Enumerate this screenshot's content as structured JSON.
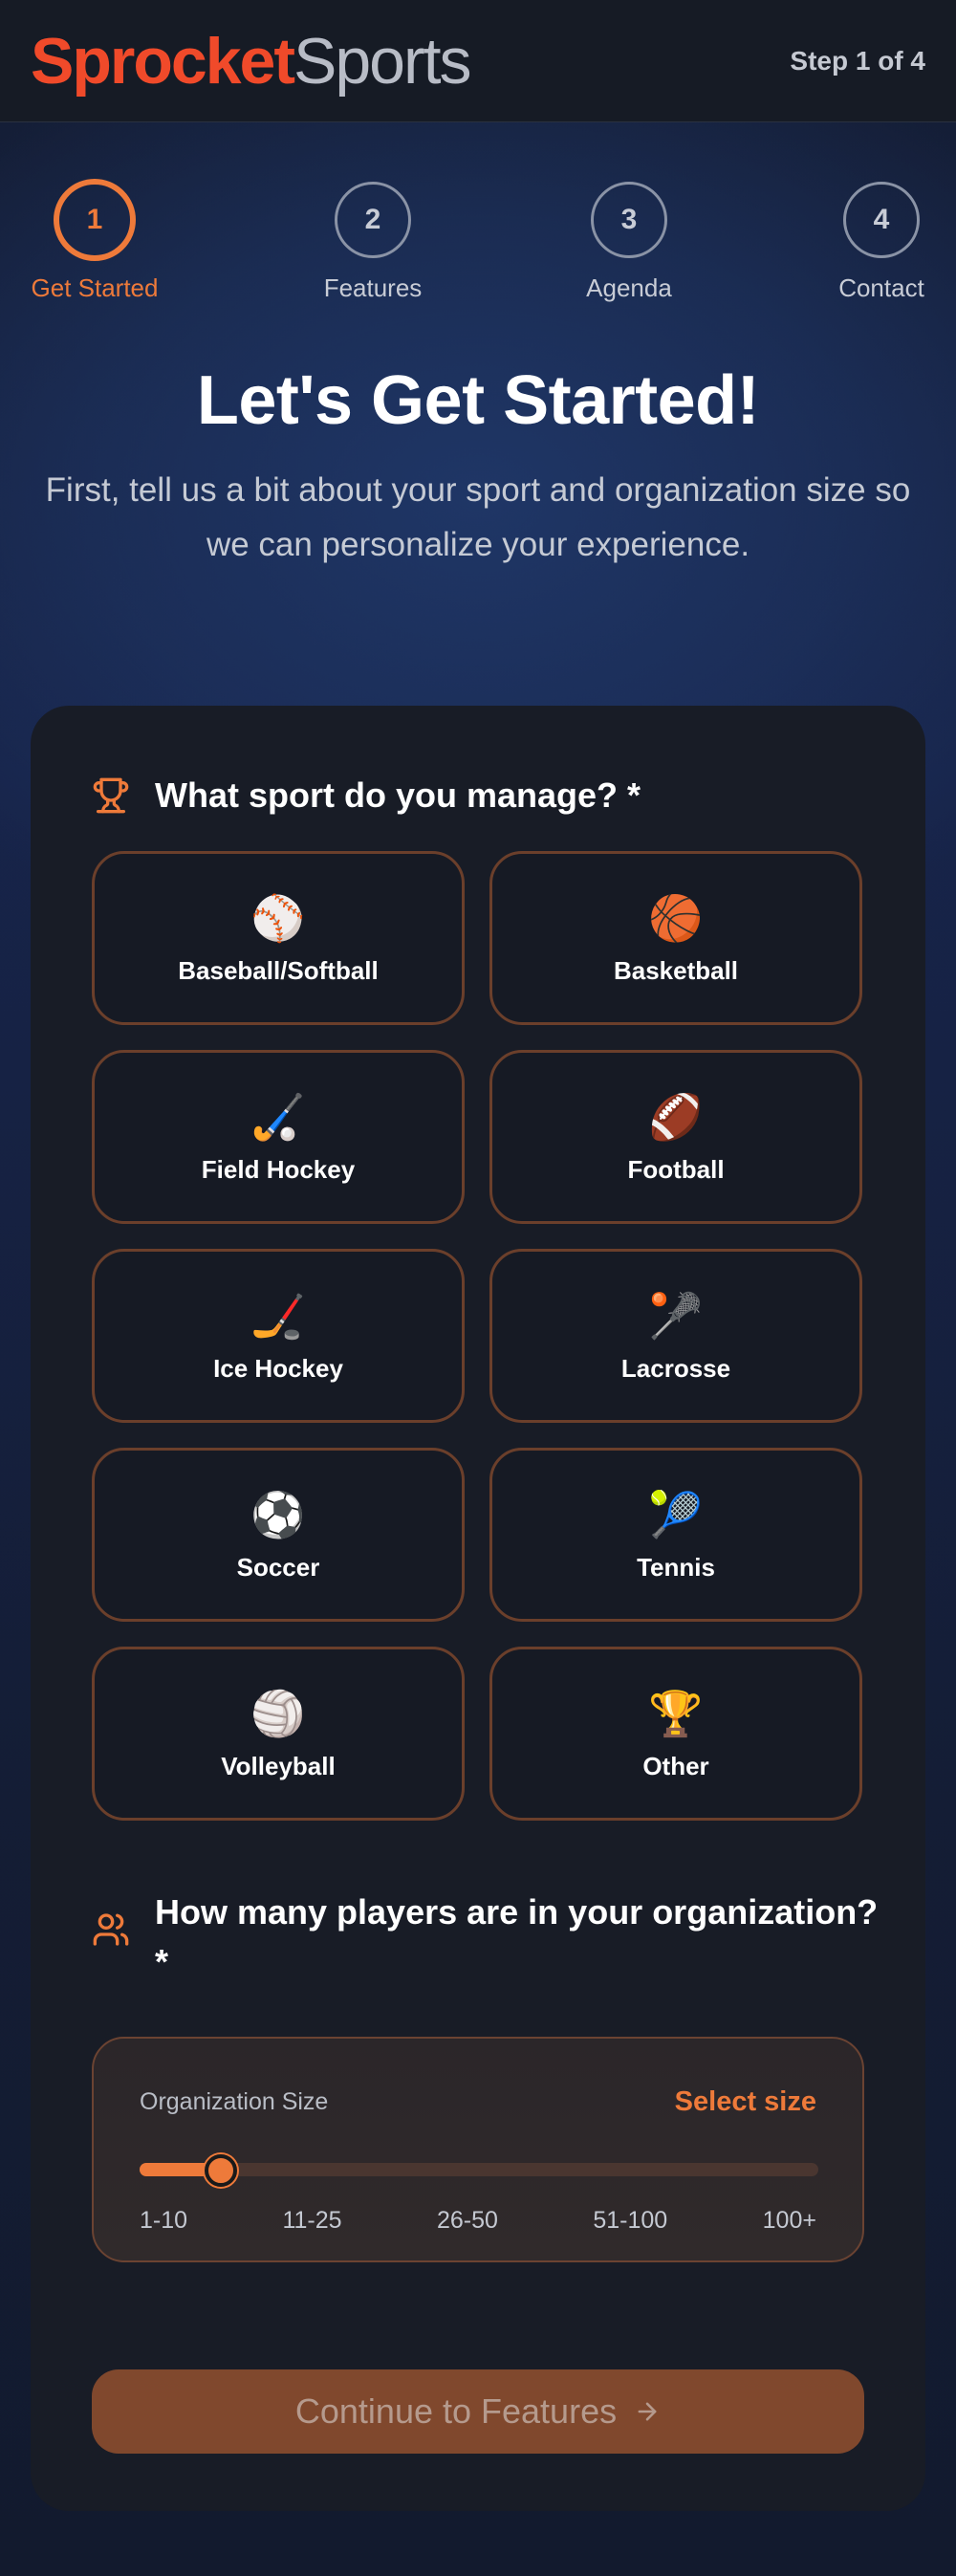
{
  "header": {
    "brand_primary": "Sprocket",
    "brand_secondary": "Sports",
    "step_text": "Step 1 of 4"
  },
  "stepper": {
    "steps": [
      {
        "number": "1",
        "label": "Get Started",
        "active": true
      },
      {
        "number": "2",
        "label": "Features",
        "active": false
      },
      {
        "number": "3",
        "label": "Agenda",
        "active": false
      },
      {
        "number": "4",
        "label": "Contact",
        "active": false
      }
    ]
  },
  "hero": {
    "title": "Let's Get Started!",
    "subtitle": "First, tell us a bit about your sport and organization size so we can personalize your experience."
  },
  "sport_section": {
    "icon": "trophy-icon",
    "question": "What sport do you manage? *",
    "sports": [
      {
        "emoji": "⚾",
        "name": "Baseball/Softball"
      },
      {
        "emoji": "🏀",
        "name": "Basketball"
      },
      {
        "emoji": "🏑",
        "name": "Field Hockey"
      },
      {
        "emoji": "🏈",
        "name": "Football"
      },
      {
        "emoji": "🏒",
        "name": "Ice Hockey"
      },
      {
        "emoji": "🥍",
        "name": "Lacrosse"
      },
      {
        "emoji": "⚽",
        "name": "Soccer"
      },
      {
        "emoji": "🎾",
        "name": "Tennis"
      },
      {
        "emoji": "🏐",
        "name": "Volleyball"
      },
      {
        "emoji": "🏆",
        "name": "Other"
      }
    ]
  },
  "size_section": {
    "icon": "users-icon",
    "question_line1": "How many players are in your organization?",
    "question_line2": "*",
    "label": "Organization Size",
    "selected_text": "Select size",
    "slider_fraction": 0.12,
    "ticks": [
      "1-10",
      "11-25",
      "26-50",
      "51-100",
      "100+"
    ]
  },
  "continue_button": {
    "label": "Continue to Features"
  },
  "colors": {
    "accent": "#ee7a3a",
    "brand_red": "#f04a2a",
    "card_bg": "#181c26",
    "button_disabled": "#80482d"
  }
}
